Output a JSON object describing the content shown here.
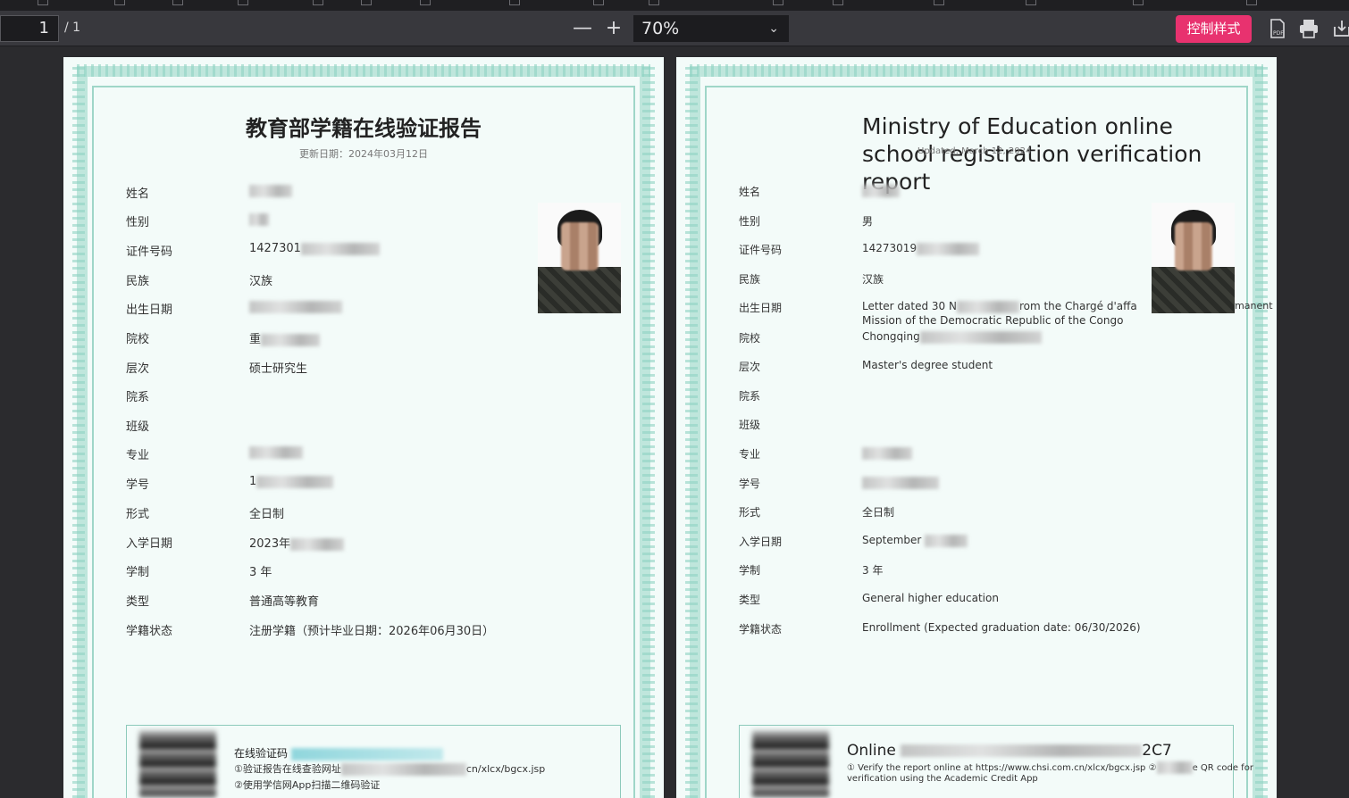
{
  "toolbar": {
    "page_current": "1",
    "page_total": "/ 1",
    "zoom_minus": "—",
    "zoom_plus": "+",
    "zoom_value": "70%",
    "zoom_chevron": "⌄",
    "control_style_button": "控制样式",
    "icons": [
      "pdf-icon",
      "print-icon",
      "download-icon"
    ],
    "accent_color": "#e8326f"
  },
  "page_cn": {
    "title": "教育部学籍在线验证报告",
    "updated": "更新日期：2024年03月12日",
    "rows": [
      {
        "label": "姓名",
        "value": ""
      },
      {
        "label": "性别",
        "value": ""
      },
      {
        "label": "证件号码",
        "value": "1427301"
      },
      {
        "label": "民族",
        "value": "汉族"
      },
      {
        "label": "出生日期",
        "value": ""
      },
      {
        "label": "院校",
        "value": "重"
      },
      {
        "label": "层次",
        "value": "硕士研究生"
      },
      {
        "label": "院系",
        "value": ""
      },
      {
        "label": "班级",
        "value": ""
      },
      {
        "label": "专业",
        "value": ""
      },
      {
        "label": "学号",
        "value": "1"
      },
      {
        "label": "形式",
        "value": "全日制"
      },
      {
        "label": "入学日期",
        "value": "2023年"
      },
      {
        "label": "学制",
        "value": "3 年"
      },
      {
        "label": "类型",
        "value": "普通高等教育"
      },
      {
        "label": "学籍状态",
        "value": "注册学籍（预计毕业日期：2026年06月30日）"
      }
    ],
    "footer": {
      "code_label": "在线验证码",
      "line1": "①验证报告在线查验网址",
      "line1_tail": "cn/xlcx/bgcx.jsp",
      "line2": "②使用学信网App扫描二维码验证"
    }
  },
  "page_en": {
    "title": "Ministry of Education online school registration verification report",
    "updated": "Updated: March 12, 2024",
    "rows": [
      {
        "label": "姓名",
        "value": ""
      },
      {
        "label": "性别",
        "value": "男"
      },
      {
        "label": "证件号码",
        "value": "14273019"
      },
      {
        "label": "民族",
        "value": "汉族"
      },
      {
        "label": "出生日期",
        "value": "Letter dated 30 N",
        "value2": "rom the Chargé d'affa",
        "value3": "ermanent",
        "value4": "Mission of the Democratic Republic of the Congo"
      },
      {
        "label": "院校",
        "value": "Chongqing"
      },
      {
        "label": "层次",
        "value": "Master's degree student"
      },
      {
        "label": "院系",
        "value": ""
      },
      {
        "label": "班级",
        "value": ""
      },
      {
        "label": "专业",
        "value": ""
      },
      {
        "label": "学号",
        "value": ""
      },
      {
        "label": "形式",
        "value": "全日制"
      },
      {
        "label": "入学日期",
        "value": "September"
      },
      {
        "label": "学制",
        "value": "3 年"
      },
      {
        "label": "类型",
        "value": "General higher education"
      },
      {
        "label": "学籍状态",
        "value": "Enrollment (Expected graduation date: 06/30/2026)"
      }
    ],
    "footer": {
      "code_label": "Online",
      "code_tail": "2C7",
      "line1": "① Verify the report online at https://www.chsi.com.cn/xlcx/bgcx.jsp ②",
      "line1_tail": "e QR code for",
      "line2": "verification using the Academic Credit App"
    }
  }
}
